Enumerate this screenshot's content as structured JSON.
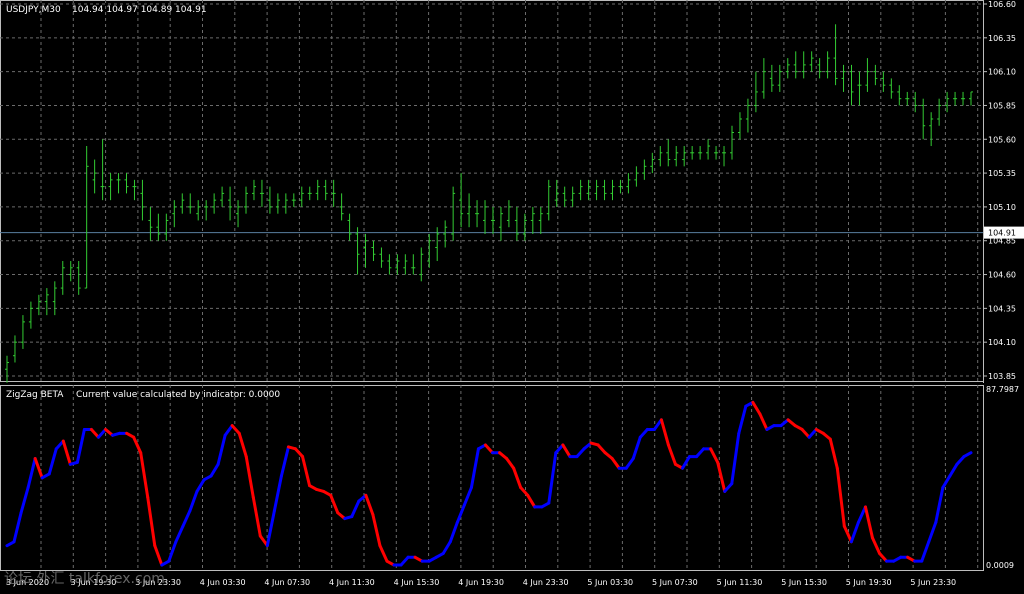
{
  "chart": {
    "symbol_title": "USDJPY,M30",
    "ohlc": "104.94 104.97 104.89 104.91",
    "price_axis": [
      "106.60",
      "106.35",
      "106.10",
      "105.85",
      "105.60",
      "105.35",
      "105.10",
      "104.85",
      "104.60",
      "104.35",
      "104.10",
      "103.85"
    ],
    "current_price_label": "104.91",
    "time_axis": [
      "3 Jun 2020",
      "3 Jun 19:30",
      "3 Jun 23:30",
      "4 Jun 03:30",
      "4 Jun 07:30",
      "4 Jun 11:30",
      "4 Jun 15:30",
      "4 Jun 19:30",
      "4 Jun 23:30",
      "5 Jun 03:30",
      "5 Jun 07:30",
      "5 Jun 11:30",
      "5 Jun 15:30",
      "5 Jun 19:30",
      "5 Jun 23:30"
    ],
    "colors": {
      "background": "#000000",
      "grid": "#6b6b6b",
      "bars": "#33cc33",
      "up": "#0000ff",
      "down": "#ff0000",
      "price_line": "#5a7fa0"
    }
  },
  "indicator": {
    "name": "ZigZag BETA",
    "caption": "Current value calculated by indicator: 0.0000",
    "max_label": "87.7987",
    "min_label": "0.0009"
  },
  "watermark": "论坛 外汇 talkforex.com",
  "chart_data": [
    {
      "type": "bar",
      "title": "USDJPY,M30",
      "ylim": [
        103.85,
        106.6
      ],
      "current": 104.91,
      "bars": [
        [
          103.9,
          104.0,
          103.8,
          103.95
        ],
        [
          104.0,
          104.15,
          103.95,
          104.1
        ],
        [
          104.1,
          104.3,
          104.05,
          104.25
        ],
        [
          104.25,
          104.4,
          104.2,
          104.35
        ],
        [
          104.35,
          104.45,
          104.3,
          104.4
        ],
        [
          104.4,
          104.5,
          104.3,
          104.45
        ],
        [
          104.4,
          104.55,
          104.3,
          104.5
        ],
        [
          104.5,
          104.7,
          104.45,
          104.65
        ],
        [
          104.6,
          104.7,
          104.55,
          104.65
        ],
        [
          104.65,
          104.7,
          104.45,
          104.5
        ],
        [
          104.5,
          105.55,
          104.5,
          105.4
        ],
        [
          105.3,
          105.45,
          105.2,
          105.35
        ],
        [
          105.25,
          105.6,
          105.15,
          105.25
        ],
        [
          105.25,
          105.35,
          105.15,
          105.3
        ],
        [
          105.3,
          105.35,
          105.2,
          105.3
        ],
        [
          105.3,
          105.35,
          105.2,
          105.25
        ],
        [
          105.25,
          105.3,
          105.15,
          105.25
        ],
        [
          105.2,
          105.3,
          105.0,
          105.1
        ],
        [
          105.0,
          105.1,
          104.85,
          104.95
        ],
        [
          104.95,
          105.05,
          104.85,
          104.9
        ],
        [
          104.9,
          105.05,
          104.85,
          105.0
        ],
        [
          105.05,
          105.15,
          104.95,
          105.1
        ],
        [
          105.1,
          105.2,
          105.05,
          105.15
        ],
        [
          105.1,
          105.2,
          105.05,
          105.1
        ],
        [
          105.05,
          105.15,
          105.0,
          105.1
        ],
        [
          105.1,
          105.15,
          105.0,
          105.1
        ],
        [
          105.1,
          105.2,
          105.05,
          105.15
        ],
        [
          105.15,
          105.25,
          105.1,
          105.2
        ],
        [
          105.15,
          105.25,
          105.0,
          105.1
        ],
        [
          105.05,
          105.15,
          104.95,
          105.1
        ],
        [
          105.1,
          105.25,
          105.05,
          105.2
        ],
        [
          105.2,
          105.3,
          105.15,
          105.25
        ],
        [
          105.2,
          105.3,
          105.1,
          105.2
        ],
        [
          105.15,
          105.25,
          105.05,
          105.1
        ],
        [
          105.1,
          105.2,
          105.05,
          105.15
        ],
        [
          105.1,
          105.2,
          105.05,
          105.15
        ],
        [
          105.15,
          105.2,
          105.1,
          105.15
        ],
        [
          105.15,
          105.25,
          105.1,
          105.2
        ],
        [
          105.2,
          105.25,
          105.15,
          105.2
        ],
        [
          105.2,
          105.3,
          105.15,
          105.25
        ],
        [
          105.25,
          105.3,
          105.15,
          105.2
        ],
        [
          105.2,
          105.3,
          105.1,
          105.2
        ],
        [
          105.1,
          105.2,
          105.0,
          105.05
        ],
        [
          105.0,
          105.05,
          104.85,
          104.9
        ],
        [
          104.9,
          104.95,
          104.6,
          104.75
        ],
        [
          104.8,
          104.9,
          104.65,
          104.85
        ],
        [
          104.8,
          104.85,
          104.7,
          104.75
        ],
        [
          104.75,
          104.8,
          104.65,
          104.7
        ],
        [
          104.7,
          104.75,
          104.6,
          104.65
        ],
        [
          104.65,
          104.75,
          104.6,
          104.7
        ],
        [
          104.65,
          104.75,
          104.6,
          104.7
        ],
        [
          104.65,
          104.75,
          104.6,
          104.65
        ],
        [
          104.6,
          104.8,
          104.55,
          104.75
        ],
        [
          104.7,
          104.9,
          104.65,
          104.85
        ],
        [
          104.8,
          104.95,
          104.7,
          104.9
        ],
        [
          104.9,
          105.0,
          104.8,
          104.95
        ],
        [
          104.9,
          105.25,
          104.85,
          105.2
        ],
        [
          105.15,
          105.35,
          104.95,
          105.05
        ],
        [
          105.05,
          105.2,
          104.95,
          105.1
        ],
        [
          105.05,
          105.15,
          104.95,
          105.05
        ],
        [
          105.0,
          105.15,
          104.9,
          105.1
        ],
        [
          105.0,
          105.1,
          104.9,
          105.0
        ],
        [
          104.95,
          105.1,
          104.85,
          105.05
        ],
        [
          105.0,
          105.15,
          104.95,
          105.1
        ],
        [
          105.0,
          105.1,
          104.85,
          104.9
        ],
        [
          104.9,
          105.05,
          104.85,
          105.0
        ],
        [
          105.0,
          105.1,
          104.9,
          105.05
        ],
        [
          105.0,
          105.1,
          104.9,
          105.05
        ],
        [
          105.05,
          105.3,
          105.0,
          105.25
        ],
        [
          105.15,
          105.3,
          105.1,
          105.2
        ],
        [
          105.2,
          105.25,
          105.1,
          105.15
        ],
        [
          105.15,
          105.25,
          105.1,
          105.2
        ],
        [
          105.2,
          105.3,
          105.15,
          105.25
        ],
        [
          105.2,
          105.3,
          105.15,
          105.25
        ],
        [
          105.2,
          105.3,
          105.15,
          105.25
        ],
        [
          105.25,
          105.3,
          105.15,
          105.2
        ],
        [
          105.2,
          105.3,
          105.15,
          105.25
        ],
        [
          105.25,
          105.3,
          105.2,
          105.25
        ],
        [
          105.25,
          105.35,
          105.2,
          105.3
        ],
        [
          105.3,
          105.4,
          105.25,
          105.35
        ],
        [
          105.35,
          105.45,
          105.3,
          105.4
        ],
        [
          105.4,
          105.5,
          105.35,
          105.45
        ],
        [
          105.45,
          105.55,
          105.4,
          105.5
        ],
        [
          105.5,
          105.6,
          105.4,
          105.45
        ],
        [
          105.45,
          105.55,
          105.4,
          105.5
        ],
        [
          105.45,
          105.55,
          105.4,
          105.5
        ],
        [
          105.5,
          105.55,
          105.45,
          105.5
        ],
        [
          105.5,
          105.55,
          105.45,
          105.5
        ],
        [
          105.5,
          105.6,
          105.45,
          105.55
        ],
        [
          105.5,
          105.55,
          105.45,
          105.5
        ],
        [
          105.5,
          105.55,
          105.4,
          105.5
        ],
        [
          105.5,
          105.7,
          105.45,
          105.65
        ],
        [
          105.65,
          105.8,
          105.6,
          105.75
        ],
        [
          105.75,
          105.9,
          105.65,
          105.85
        ],
        [
          105.85,
          106.1,
          105.8,
          105.95
        ],
        [
          105.95,
          106.2,
          105.9,
          106.1
        ],
        [
          106.05,
          106.15,
          105.95,
          106.0
        ],
        [
          106.0,
          106.15,
          105.95,
          106.1
        ],
        [
          106.1,
          106.2,
          106.05,
          106.15
        ],
        [
          106.15,
          106.25,
          106.05,
          106.1
        ],
        [
          106.1,
          106.25,
          106.05,
          106.15
        ],
        [
          106.15,
          106.25,
          106.1,
          106.2
        ],
        [
          106.15,
          106.2,
          106.05,
          106.1
        ],
        [
          106.1,
          106.25,
          106.05,
          106.2
        ],
        [
          106.2,
          106.45,
          106.0,
          106.05
        ],
        [
          106.05,
          106.15,
          105.95,
          106.1
        ],
        [
          106.1,
          106.15,
          105.85,
          105.95
        ],
        [
          106.0,
          106.1,
          105.85,
          106.0
        ],
        [
          106.0,
          106.2,
          105.95,
          106.1
        ],
        [
          106.1,
          106.15,
          106.0,
          106.05
        ],
        [
          106.05,
          106.1,
          105.95,
          106.0
        ],
        [
          106.0,
          106.05,
          105.9,
          105.95
        ],
        [
          105.95,
          106.0,
          105.85,
          105.9
        ],
        [
          105.9,
          105.95,
          105.85,
          105.9
        ],
        [
          105.9,
          105.95,
          105.8,
          105.85
        ],
        [
          105.85,
          105.9,
          105.6,
          105.7
        ],
        [
          105.7,
          105.8,
          105.55,
          105.75
        ],
        [
          105.75,
          105.9,
          105.7,
          105.85
        ],
        [
          105.85,
          105.95,
          105.8,
          105.9
        ],
        [
          105.9,
          105.95,
          105.85,
          105.9
        ],
        [
          105.9,
          105.95,
          105.85,
          105.9
        ],
        [
          105.9,
          105.95,
          105.85,
          105.95
        ]
      ]
    },
    {
      "type": "line",
      "title": "ZigZag BETA",
      "ylim": [
        0.0009,
        87.7987
      ],
      "values": [
        10,
        12,
        27,
        40,
        55,
        45,
        47,
        60,
        64,
        52,
        53,
        70,
        70,
        66,
        70,
        67,
        68,
        68,
        66,
        58,
        35,
        10,
        0,
        2,
        12,
        20,
        28,
        38,
        44,
        46,
        52,
        67,
        72,
        68,
        56,
        35,
        15,
        10,
        28,
        46,
        61,
        60,
        56,
        41,
        39,
        38,
        36,
        27,
        24,
        25,
        33,
        36,
        26,
        10,
        2,
        0,
        0,
        4,
        4,
        2,
        2,
        4,
        6,
        12,
        22,
        31,
        40,
        60,
        62,
        58,
        58,
        55,
        50,
        40,
        36,
        30,
        30,
        32,
        58,
        62,
        56,
        56,
        60,
        63,
        62,
        58,
        55,
        50,
        50,
        55,
        66,
        70,
        70,
        75,
        62,
        52,
        50,
        56,
        56,
        60,
        60,
        53,
        38,
        42,
        68,
        82,
        84,
        78,
        70,
        72,
        72,
        75,
        72,
        70,
        66,
        70,
        68,
        65,
        50,
        20,
        12,
        22,
        30,
        14,
        6,
        2,
        2,
        4,
        4,
        2,
        2,
        12,
        22,
        40,
        46,
        52,
        56,
        58
      ]
    }
  ]
}
